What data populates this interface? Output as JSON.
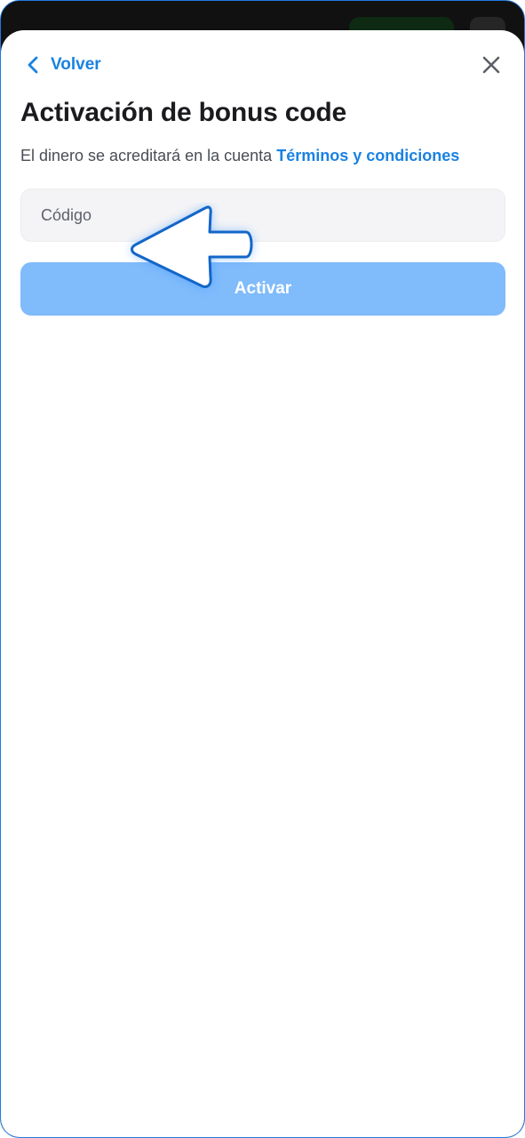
{
  "header": {
    "back_label": "Volver",
    "back_icon": "chevron-left-icon",
    "close_icon": "close-icon"
  },
  "main": {
    "title": "Activación de bonus code",
    "subtitle_text": "El dinero se acreditará en la cuenta",
    "terms_link": "Términos y condiciones",
    "code_input": {
      "placeholder": "Código",
      "value": ""
    },
    "activate_label": "Activar"
  },
  "colors": {
    "accent": "#1a82e2",
    "button_disabled": "#80bbfb",
    "input_bg": "#f4f4f6",
    "title_text": "#1b1b1f",
    "frame_border": "#1f7ae0"
  },
  "overlay": {
    "pointer_icon": "pointing-hand-arrow-icon"
  }
}
